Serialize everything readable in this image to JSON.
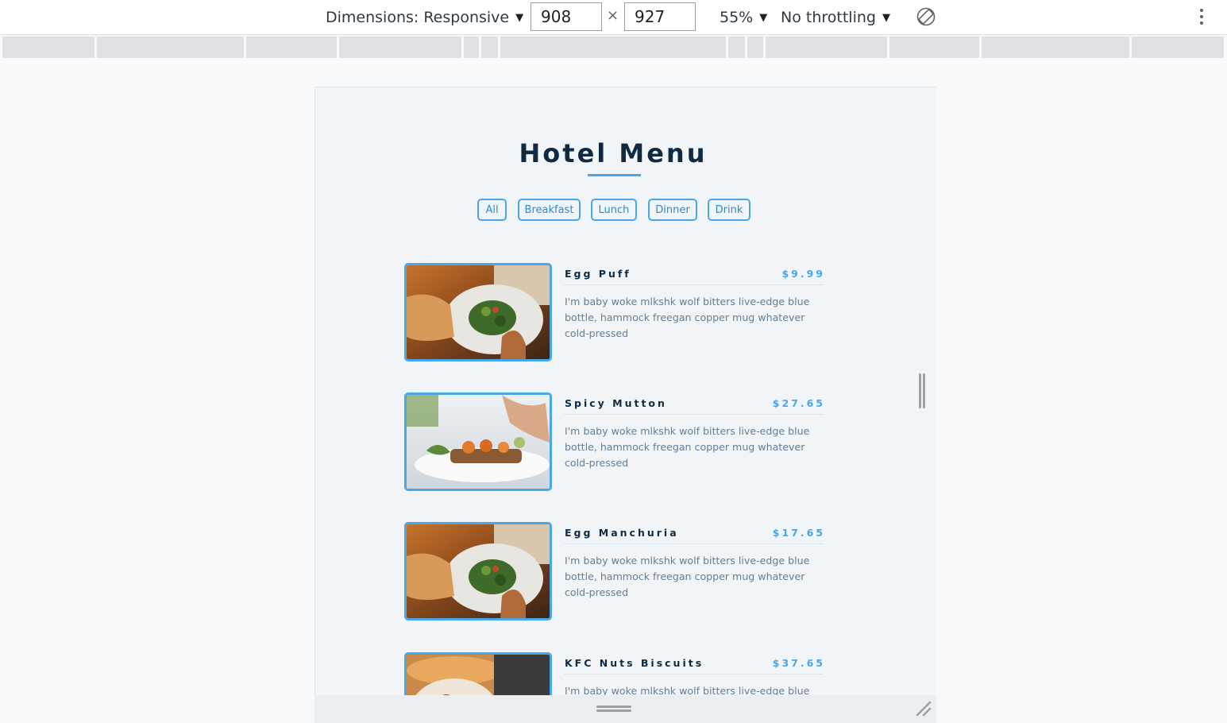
{
  "devtools": {
    "dimensions_label": "Dimensions: Responsive",
    "width_value": "908",
    "height_value": "927",
    "times_symbol": "×",
    "zoom_label": "55%",
    "throttling_label": "No throttling",
    "caret": "▼"
  },
  "page": {
    "title": "Hotel Menu",
    "filters": [
      "All",
      "Breakfast",
      "Lunch",
      "Dinner",
      "Drink"
    ],
    "items": [
      {
        "name": "Egg Puff",
        "price": "$9.99",
        "description": "I'm baby woke mlkshk wolf bitters live-edge blue bottle, hammock freegan copper mug whatever cold-pressed"
      },
      {
        "name": "Spicy Mutton",
        "price": "$27.65",
        "description": "I'm baby woke mlkshk wolf bitters live-edge blue bottle, hammock freegan copper mug whatever cold-pressed"
      },
      {
        "name": "Egg Manchuria",
        "price": "$17.65",
        "description": "I'm baby woke mlkshk wolf bitters live-edge blue bottle, hammock freegan copper mug whatever cold-pressed"
      },
      {
        "name": "KFC Nuts Biscuits",
        "price": "$37.65",
        "description": "I'm baby woke mlkshk wolf bitters live-edge blue"
      }
    ]
  },
  "colors": {
    "accent": "#49a6e9",
    "heading": "#102a42",
    "body_text": "#617d98",
    "page_bg": "#f1f5f8"
  }
}
